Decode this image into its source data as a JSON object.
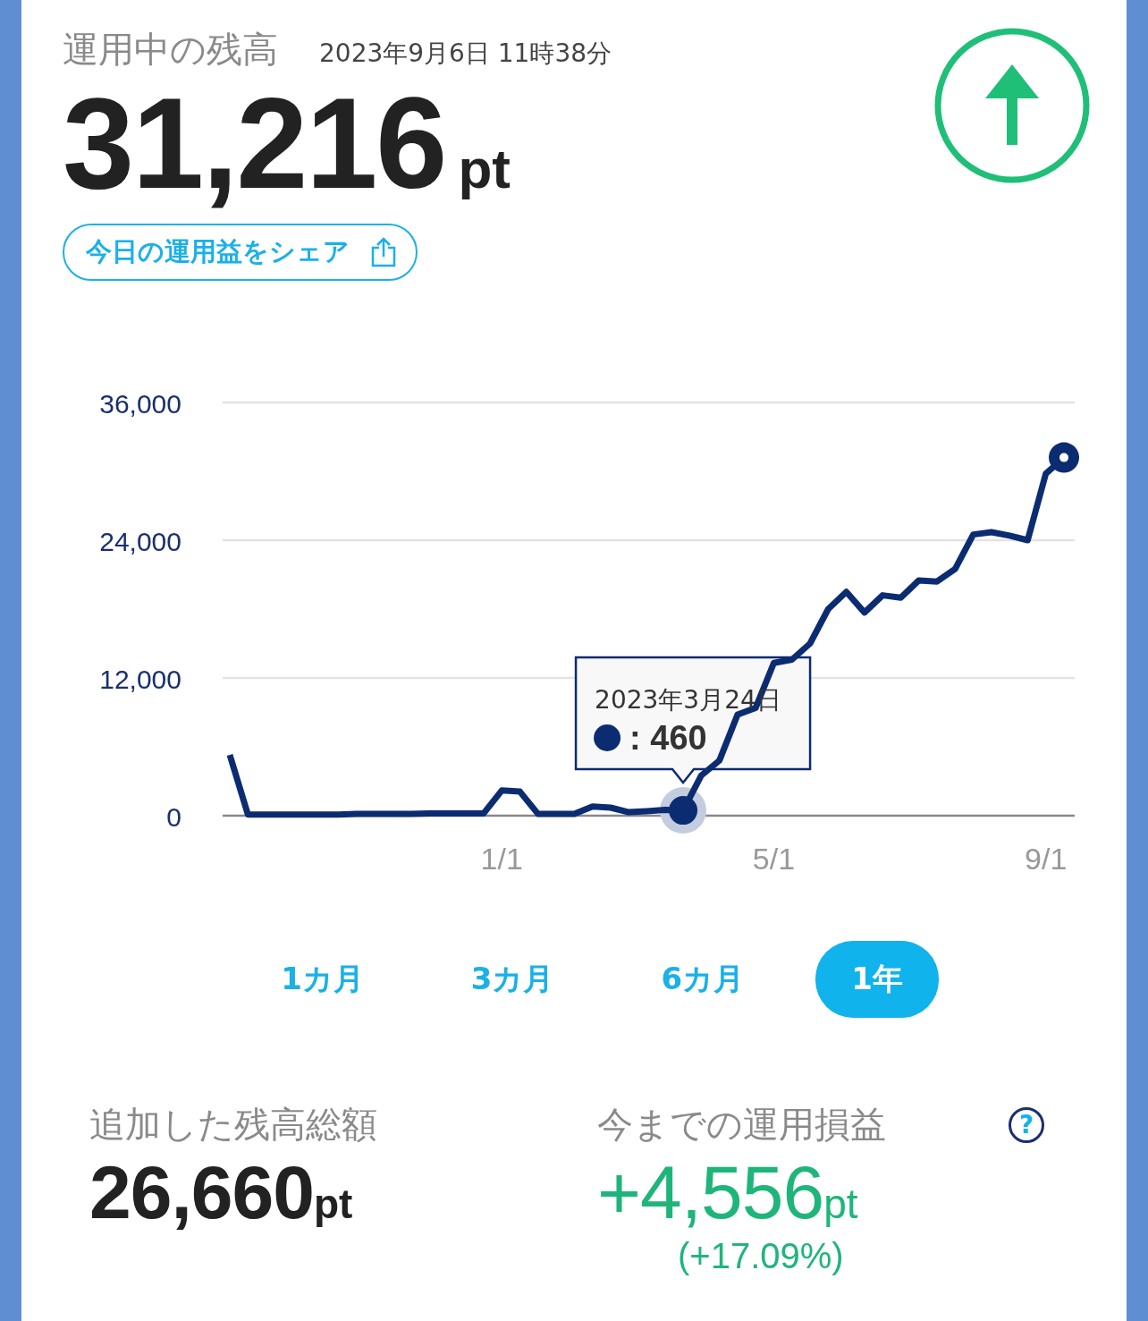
{
  "header": {
    "title": "運用中の残高",
    "timestamp": "2023年9月6日 11時38分",
    "balance": "31,216",
    "unit": "pt"
  },
  "share_button": {
    "label": "今日の運用益をシェア"
  },
  "chart": {
    "chart_data": {
      "type": "line",
      "categories": [
        null,
        null,
        null,
        null,
        null,
        null,
        null,
        null,
        null,
        null,
        null,
        null,
        null,
        null,
        null,
        "1/1",
        null,
        null,
        null,
        null,
        null,
        null,
        null,
        null,
        null,
        null,
        null,
        null,
        null,
        null,
        "5/1",
        null,
        null,
        null,
        null,
        null,
        null,
        null,
        null,
        null,
        null,
        null,
        null,
        null,
        null,
        "9/1",
        null
      ],
      "series": [
        {
          "color": "#0c2c72",
          "values": [
            5300,
            100,
            100,
            100,
            100,
            100,
            100,
            150,
            150,
            150,
            150,
            200,
            200,
            200,
            200,
            2200,
            2100,
            150,
            150,
            150,
            800,
            700,
            300,
            400,
            500,
            460,
            3500,
            4800,
            8800,
            9400,
            13300,
            13600,
            15000,
            18000,
            19500,
            17700,
            19200,
            19000,
            20500,
            20400,
            21500,
            24500,
            24700,
            24400,
            24000,
            29800,
            31200
          ]
        },
        {
          "color": "#0c2c72",
          "marker": "circle",
          "values": [
            null,
            null,
            null,
            null,
            null,
            null,
            null,
            null,
            null,
            null,
            null,
            null,
            null,
            null,
            null,
            null,
            null,
            null,
            null,
            null,
            null,
            null,
            null,
            null,
            null,
            460,
            null,
            null,
            null,
            null,
            null,
            null,
            null,
            null,
            null,
            null,
            null,
            null,
            null,
            null,
            null,
            null,
            null,
            null,
            null,
            null,
            null
          ]
        }
      ],
      "ylim": [
        0,
        36000
      ],
      "yticks": [
        {
          "value": 0,
          "label": "0"
        },
        {
          "value": 12000,
          "label": "12,000"
        },
        {
          "value": 24000,
          "label": "24,000"
        },
        {
          "value": 36000,
          "label": "36,000"
        }
      ],
      "annotations": [
        "2023年3月24日"
      ]
    },
    "tooltip_value": ": 460"
  },
  "periods": [
    {
      "label": "1カ月",
      "selected": false
    },
    {
      "label": "3カ月",
      "selected": false
    },
    {
      "label": "6カ月",
      "selected": false
    },
    {
      "label": "1年",
      "selected": true
    }
  ],
  "summary": [
    {
      "label": "追加した残高総額",
      "value": "26,660",
      "unit": "pt",
      "color": "#222222"
    },
    {
      "label": "今までの運用損益",
      "value": "+4,556",
      "unit": "pt",
      "color": "#1fb57a",
      "percent": "(+17.09%)",
      "help": "?"
    }
  ]
}
